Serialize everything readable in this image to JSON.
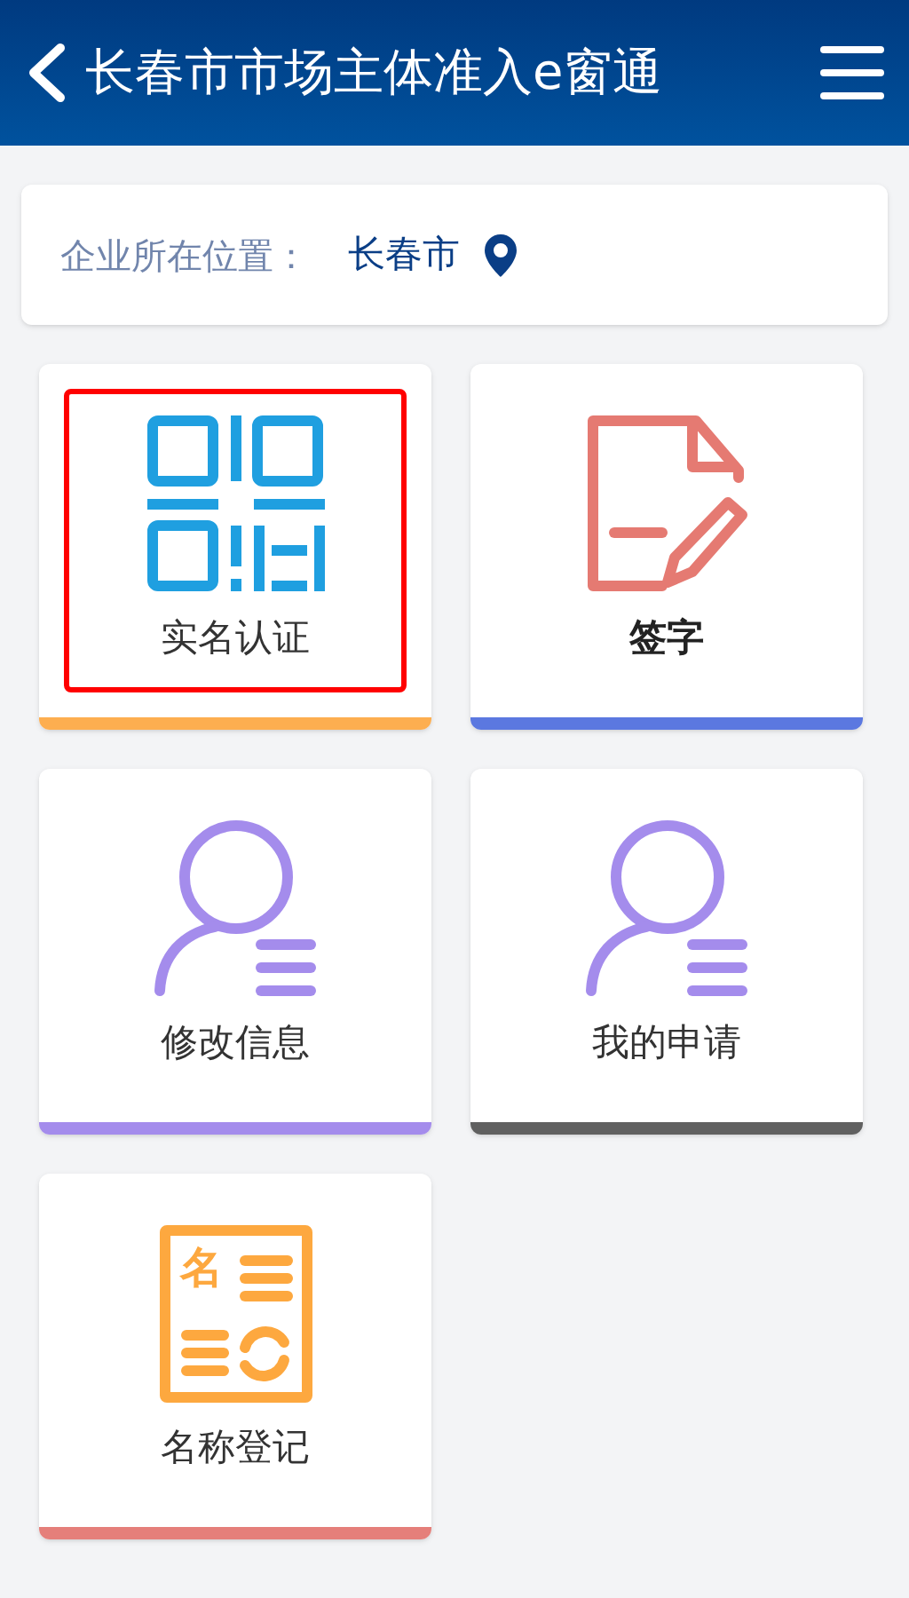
{
  "header": {
    "title": "长春市市场主体准入e窗通"
  },
  "location": {
    "label": "企业所在位置：",
    "value": "长春市"
  },
  "tiles": [
    {
      "label": "实名认证",
      "kind": "qr",
      "color": "#fdae50",
      "highlighted": true,
      "bold": false
    },
    {
      "label": "签字",
      "kind": "sign",
      "color": "#5b78e0",
      "highlighted": false,
      "bold": true
    },
    {
      "label": "修改信息",
      "kind": "person",
      "color": "#a48cec",
      "highlighted": false,
      "bold": false
    },
    {
      "label": "我的申请",
      "kind": "person",
      "color": "#606060",
      "highlighted": false,
      "bold": false
    },
    {
      "label": "名称登记",
      "kind": "name-doc",
      "color": "#e57f7a",
      "highlighted": false,
      "bold": false,
      "icon_text": "名"
    }
  ]
}
